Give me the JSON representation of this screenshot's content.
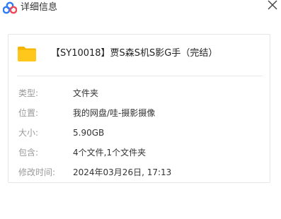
{
  "window": {
    "title": "详细信息",
    "logo_icon": "cloud-logo-icon",
    "close_icon": "close-icon"
  },
  "file": {
    "icon": "folder-icon",
    "name": "【SY10018】贾S森S机S影G手（完结）"
  },
  "details": [
    {
      "label": "类型:",
      "value": "文件夹"
    },
    {
      "label": "位置:",
      "value": "我的网盘/哇-摄影摄像"
    },
    {
      "label": "大小:",
      "value": "5.90GB"
    },
    {
      "label": "包含:",
      "value": "4个文件,1个文件夹"
    },
    {
      "label": "修改时间:",
      "value": "2024年03月26日, 17:13"
    }
  ],
  "colors": {
    "logo_blue": "#2f7cf6",
    "logo_red": "#f2495a",
    "folder_yellow": "#ffc61b",
    "label_gray": "#999999"
  }
}
